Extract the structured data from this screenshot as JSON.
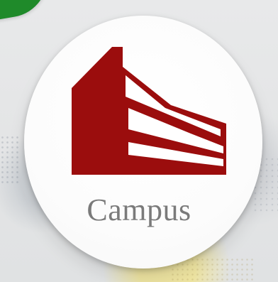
{
  "tile": {
    "label": "Campus",
    "icon": "building-icon",
    "colors": {
      "icon": "#9b0d0d",
      "label": "#7a7a7a",
      "tile": "#ffffff",
      "corner_accent": "#1f8a2a"
    }
  }
}
